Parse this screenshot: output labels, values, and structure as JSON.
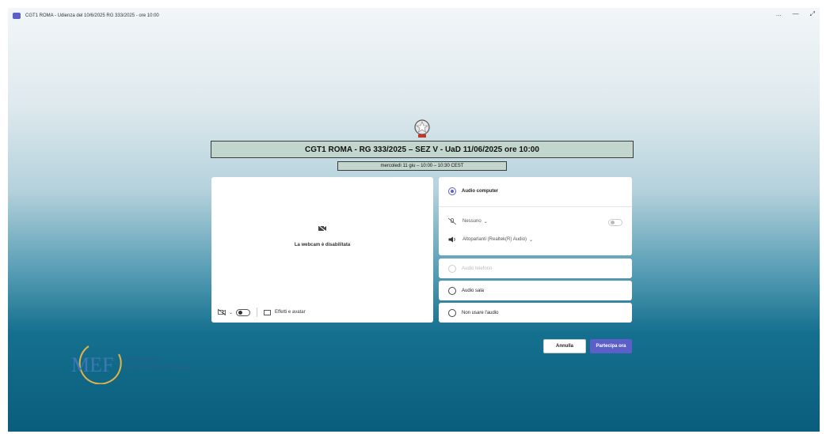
{
  "window": {
    "title": "CGT1 ROMA - Udienza del 10/6/2025 RG 333/2025 - ore 10:00",
    "controls": [
      "...",
      "—",
      "⤢"
    ]
  },
  "banner": {
    "main": "CGT1 ROMA - RG 333/2025 – SEZ V - UaD 11/06/2025 ore 10:00",
    "sub": "mercoledì 11 giu – 10:00 – 10:30 CEST"
  },
  "video": {
    "status": "La webcam è disabilitata",
    "effects_label": "Effetti e avatar",
    "camera_toggle_on": false
  },
  "audio": {
    "selected_option": "Audio computer",
    "microphone": "Nessuno",
    "speakers": "Altoparlanti (Realtek(R) Audio)",
    "options": [
      {
        "label": "Audio telefono",
        "disabled": true
      },
      {
        "label": "Audio sala",
        "disabled": false
      },
      {
        "label": "Non usare l'audio",
        "disabled": false
      }
    ]
  },
  "buttons": {
    "cancel": "Annulla",
    "join": "Partecipa ora"
  },
  "logo": {
    "mark": "MEF",
    "line1": "Dipartimento",
    "line2": "della Giustizia Tributaria"
  },
  "colors": {
    "accent": "#5b5fc7",
    "banner_bg": "#c3d6ce",
    "logo_text": "#2a5f88"
  }
}
